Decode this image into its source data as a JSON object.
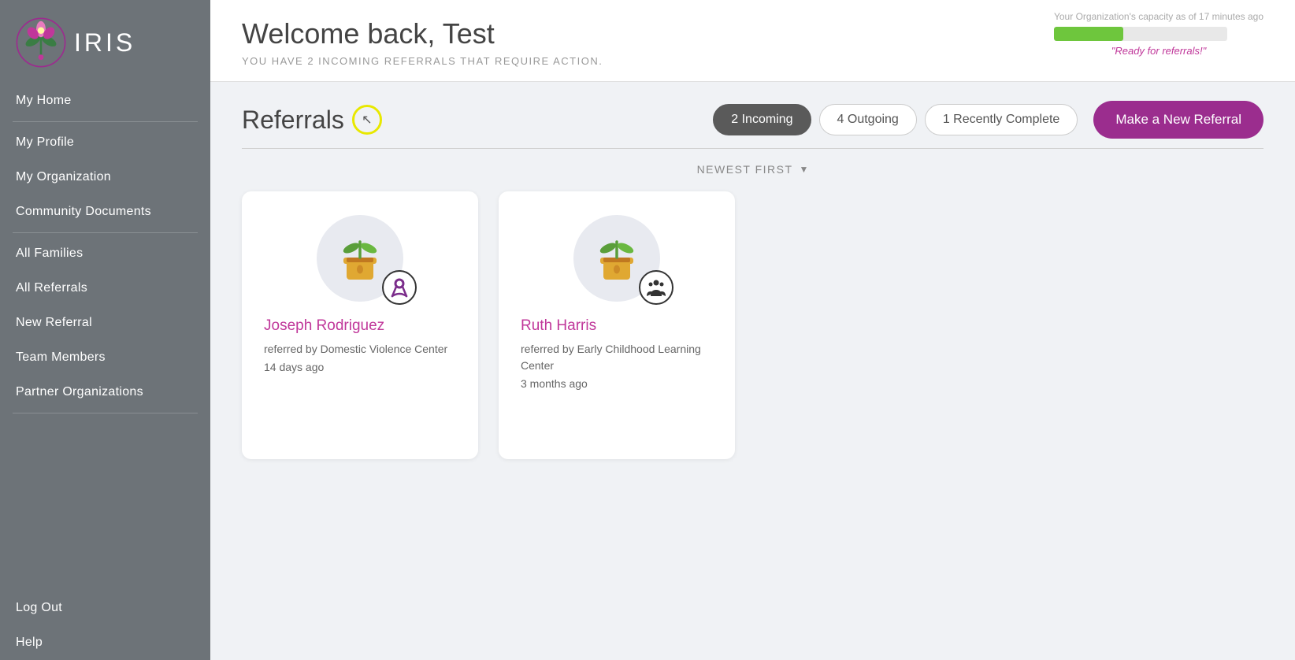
{
  "sidebar": {
    "logo_text": "IRIS",
    "items": [
      {
        "label": "My Home",
        "name": "sidebar-item-home"
      },
      {
        "label": "My Profile",
        "name": "sidebar-item-profile"
      },
      {
        "label": "My Organization",
        "name": "sidebar-item-org"
      },
      {
        "label": "Community Documents",
        "name": "sidebar-item-docs"
      },
      {
        "label": "All Families",
        "name": "sidebar-item-families"
      },
      {
        "label": "All Referrals",
        "name": "sidebar-item-all-referrals"
      },
      {
        "label": "New Referral",
        "name": "sidebar-item-new-referral"
      },
      {
        "label": "Team Members",
        "name": "sidebar-item-team"
      },
      {
        "label": "Partner Organizations",
        "name": "sidebar-item-partners"
      },
      {
        "label": "Log Out",
        "name": "sidebar-item-logout"
      },
      {
        "label": "Help",
        "name": "sidebar-item-help"
      }
    ]
  },
  "header": {
    "welcome_title": "Welcome back, Test",
    "subtitle": "YOU HAVE 2 INCOMING REFERRALS THAT REQUIRE ACTION.",
    "capacity_label": "Your Organization's capacity as of 17 minutes ago",
    "capacity_percent": 40,
    "capacity_status": "\"Ready for referrals!\""
  },
  "referrals": {
    "section_title": "Referrals",
    "tabs": [
      {
        "label": "2 Incoming",
        "active": true
      },
      {
        "label": "4 Outgoing",
        "active": false
      },
      {
        "label": "1 Recently Complete",
        "active": false
      }
    ],
    "make_new_label": "Make a New Referral",
    "sort_label": "NEWEST FIRST",
    "cards": [
      {
        "name": "Joseph Rodriguez",
        "referred_by": "referred by Domestic Violence Center",
        "time_ago": "14 days ago",
        "org_icon": "ribbon"
      },
      {
        "name": "Ruth Harris",
        "referred_by": "referred by Early Childhood Learning Center",
        "time_ago": "3 months ago",
        "org_icon": "people"
      }
    ]
  }
}
